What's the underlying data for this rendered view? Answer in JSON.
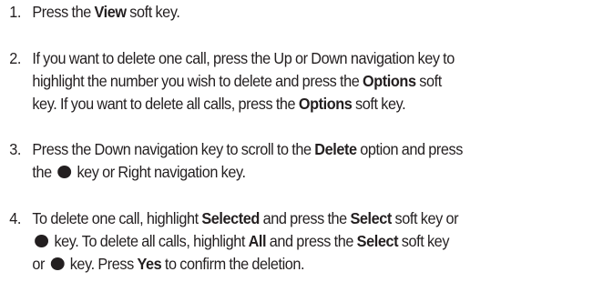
{
  "steps": [
    {
      "number": "1.",
      "lines": [
        [
          {
            "t": "Press the ",
            "b": false
          },
          {
            "t": "View",
            "b": true
          },
          {
            "t": " soft key.",
            "b": false
          }
        ]
      ]
    },
    {
      "number": "2.",
      "lines": [
        [
          {
            "t": "If you want to delete one call, press the Up or Down navigation key to",
            "b": false
          }
        ],
        [
          {
            "t": "highlight the number you wish to delete and press the ",
            "b": false
          },
          {
            "t": "Options",
            "b": true
          },
          {
            "t": " soft",
            "b": false
          }
        ],
        [
          {
            "t": "key. If you want to delete all calls, press the ",
            "b": false
          },
          {
            "t": "Options",
            "b": true
          },
          {
            "t": " soft key.",
            "b": false
          }
        ]
      ]
    },
    {
      "number": "3.",
      "lines": [
        [
          {
            "t": "Press the Down navigation key to scroll to the ",
            "b": false
          },
          {
            "t": "Delete",
            "b": true
          },
          {
            "t": " option and press",
            "b": false
          }
        ],
        [
          {
            "t": "the ",
            "b": false
          },
          {
            "icon": "select-key-icon"
          },
          {
            "t": " key or Right navigation key.",
            "b": false
          }
        ]
      ]
    },
    {
      "number": "4.",
      "lines": [
        [
          {
            "t": "To delete one call, highlight ",
            "b": false
          },
          {
            "t": "Selected",
            "b": true
          },
          {
            "t": " and press the ",
            "b": false
          },
          {
            "t": "Select",
            "b": true
          },
          {
            "t": " soft key or",
            "b": false
          }
        ],
        [
          {
            "icon": "select-key-icon"
          },
          {
            "t": " key. To delete all calls, highlight ",
            "b": false
          },
          {
            "t": "All",
            "b": true
          },
          {
            "t": " and press the ",
            "b": false
          },
          {
            "t": "Select",
            "b": true
          },
          {
            "t": " soft key",
            "b": false
          }
        ],
        [
          {
            "t": "or ",
            "b": false
          },
          {
            "icon": "select-key-icon"
          },
          {
            "t": " key. Press ",
            "b": false
          },
          {
            "t": "Yes",
            "b": true
          },
          {
            "t": " to confirm the deletion.",
            "b": false
          }
        ]
      ]
    }
  ]
}
